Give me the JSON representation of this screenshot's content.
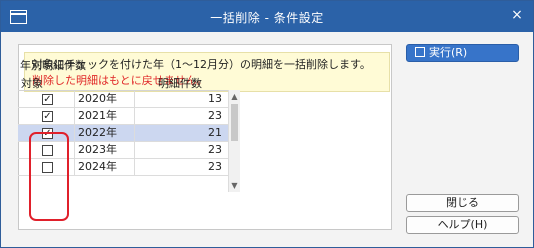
{
  "window": {
    "title": "一括削除 - 条件設定",
    "close_glyph": "×"
  },
  "notice": {
    "line1": "対象にチェックを付けた年（1～12月分）の明細を一括削除します。",
    "line2": "削除した明細はもとに戻せません。"
  },
  "section_label": "年別明細件数",
  "grid": {
    "headers": {
      "target": "対象",
      "count": "明細件数"
    },
    "rows": [
      {
        "checked": true,
        "year": "2020年",
        "count": "13",
        "selected": false
      },
      {
        "checked": true,
        "year": "2021年",
        "count": "23",
        "selected": false
      },
      {
        "checked": true,
        "year": "2022年",
        "count": "21",
        "selected": true
      },
      {
        "checked": false,
        "year": "2023年",
        "count": "23",
        "selected": false
      },
      {
        "checked": false,
        "year": "2024年",
        "count": "23",
        "selected": false
      }
    ]
  },
  "buttons": {
    "execute": "実行(R)",
    "close": "閉じる",
    "help": "ヘルプ(H)"
  },
  "colors": {
    "titlebar": "#2b62a8",
    "warning_text": "#e02828",
    "selected_row": "#ccd7f0",
    "annotation_box": "#e0202b"
  }
}
